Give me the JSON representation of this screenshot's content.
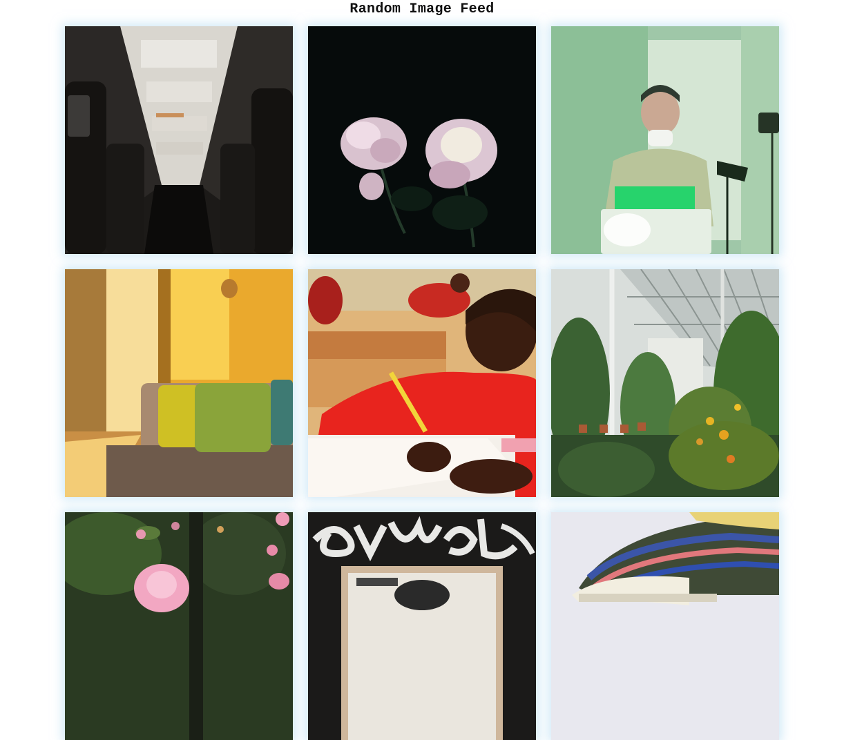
{
  "header": {
    "title": "Random Image Feed"
  },
  "feed": {
    "images": [
      {
        "subject": "airplane cabin aisle"
      },
      {
        "subject": "pink peonies on black background"
      },
      {
        "subject": "man with mask at laptop under green light"
      },
      {
        "subject": "sofa with green pillows in sunlit yellow room"
      },
      {
        "subject": "smiling girl writing in classroom"
      },
      {
        "subject": "plants in greenhouse"
      },
      {
        "subject": "pink flowers on shrub"
      },
      {
        "subject": "graffiti wall with poster"
      },
      {
        "subject": "colorful striped sneaker"
      }
    ]
  }
}
